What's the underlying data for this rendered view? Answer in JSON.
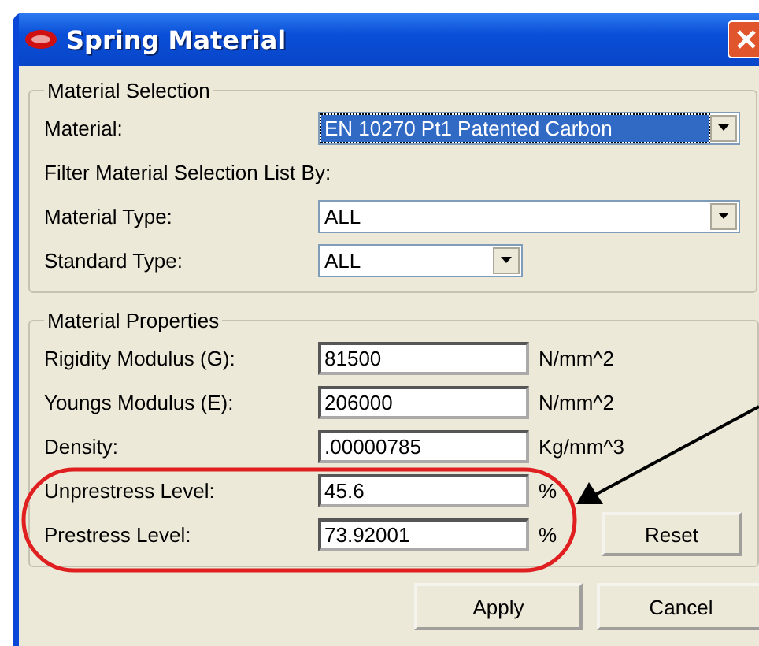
{
  "window": {
    "title": "Spring Material"
  },
  "material_selection": {
    "title": "Material Selection",
    "rows": [
      {
        "kind": "combo",
        "label": "Material:",
        "value": "EN 10270 Pt1 Patented Carbon",
        "focused": true
      },
      {
        "kind": "note",
        "label": "Filter Material Selection List By:"
      },
      {
        "kind": "combo",
        "label": "Material Type:",
        "value": "ALL",
        "focused": false
      },
      {
        "kind": "shortcombo",
        "label": "Standard Type:",
        "value": "ALL",
        "focused": false
      }
    ]
  },
  "material_properties": {
    "title": "Material Properties",
    "rows": [
      {
        "label": "Rigidity Modulus (G):",
        "value": "81500",
        "unit": "N/mm^2"
      },
      {
        "label": "Youngs Modulus (E):",
        "value": "206000",
        "unit": "N/mm^2"
      },
      {
        "label": "Density:",
        "value": ".00000785",
        "unit": "Kg/mm^3"
      },
      {
        "label": "Unprestress Level:",
        "value": "45.6",
        "unit": "%"
      },
      {
        "label": "Prestress Level:",
        "value": "73.92001",
        "unit": "%"
      }
    ],
    "reset_button": "Reset"
  },
  "buttons": [
    "Apply",
    "Cancel"
  ]
}
